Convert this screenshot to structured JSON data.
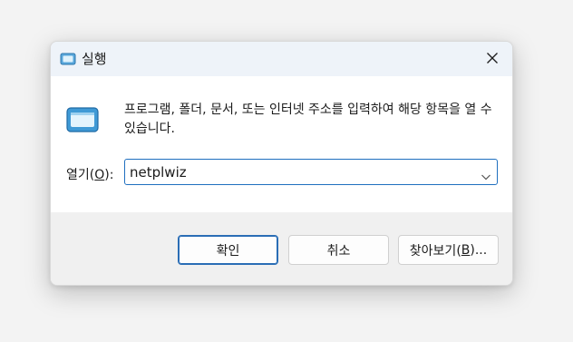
{
  "window": {
    "title": "실행",
    "icon": "run-icon",
    "close_icon": "close-icon"
  },
  "content": {
    "description": "프로그램, 폴더, 문서, 또는 인터넷 주소를 입력하여 해당 항목을 열 수 있습니다.",
    "open_label_prefix": "열기(",
    "open_label_key": "O",
    "open_label_suffix": "):",
    "input_value": "netplwiz"
  },
  "buttons": {
    "ok": "확인",
    "cancel": "취소",
    "browse_prefix": "찾아보기(",
    "browse_key": "B",
    "browse_suffix": ")..."
  },
  "colors": {
    "accent": "#1f6fbf",
    "title_bar": "#eef3f9",
    "footer": "#f0f0f0"
  }
}
